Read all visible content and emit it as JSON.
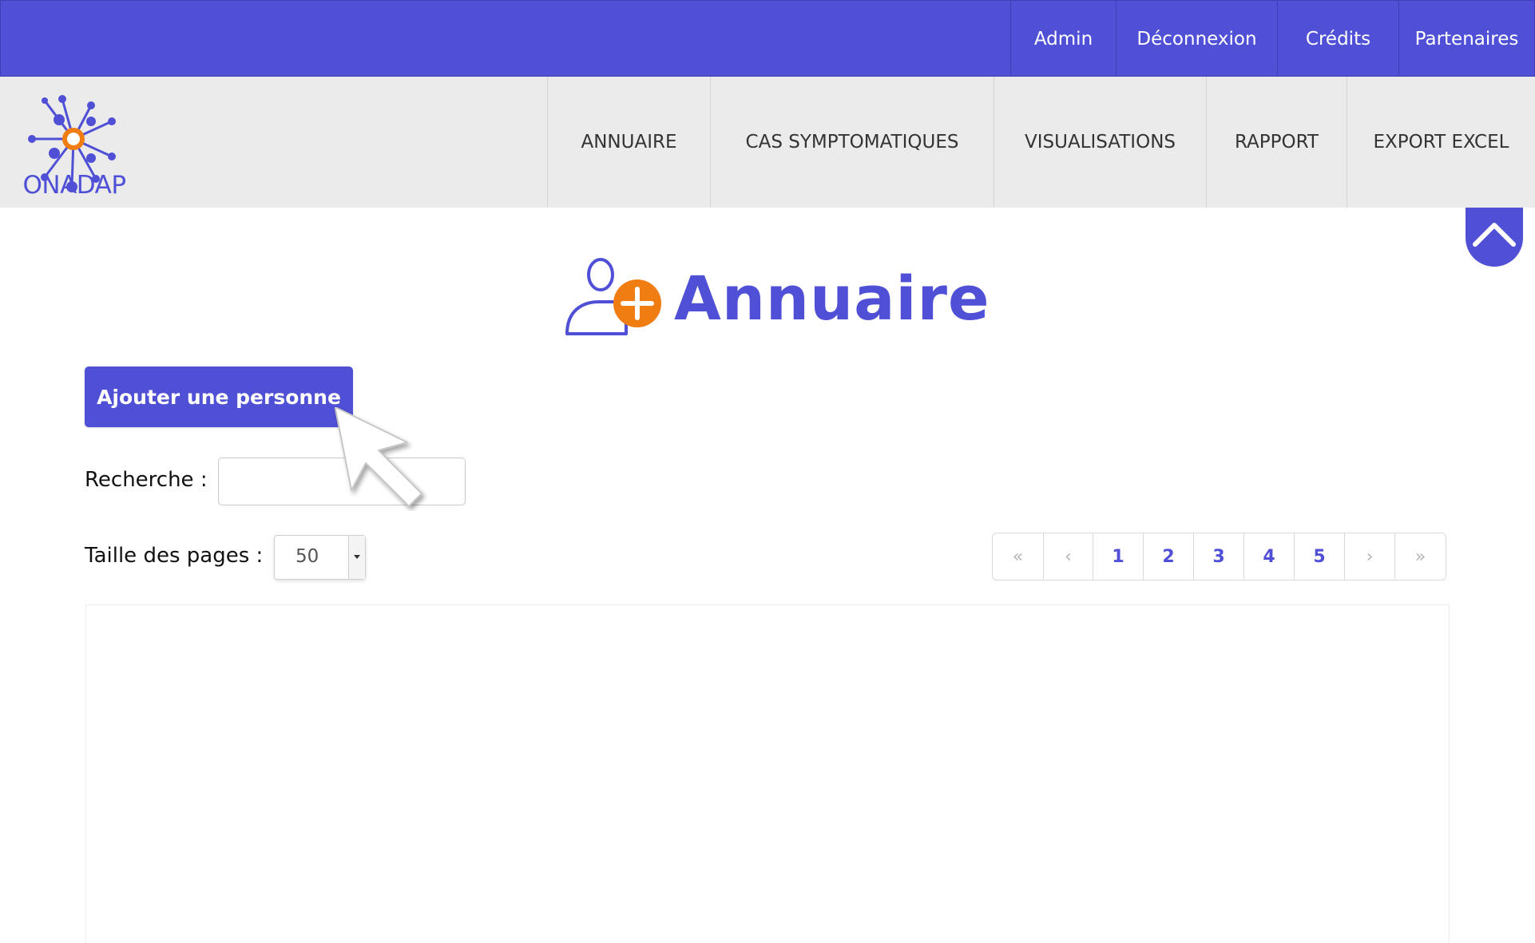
{
  "topbar": {
    "links": [
      {
        "label": "Admin",
        "name": "topbar-link-admin"
      },
      {
        "label": "Déconnexion",
        "name": "topbar-link-deconnexion"
      },
      {
        "label": "Crédits",
        "name": "topbar-link-credits"
      },
      {
        "label": "Partenaires",
        "name": "topbar-link-partenaires"
      }
    ]
  },
  "nav": {
    "logo_text": "ONADAP",
    "items": [
      {
        "label": "ANNUAIRE"
      },
      {
        "label": "CAS SYMPTOMATIQUES"
      },
      {
        "label": "VISUALISATIONS"
      },
      {
        "label": "RAPPORT"
      },
      {
        "label": "EXPORT EXCEL"
      }
    ]
  },
  "page": {
    "title": "Annuaire",
    "add_button_label": "Ajouter une personne",
    "search_label": "Recherche :",
    "search_value": "",
    "page_size_label": "Taille des pages :",
    "page_size_value": "50"
  },
  "pager": {
    "first": "«",
    "prev": "‹",
    "pages": [
      "1",
      "2",
      "3",
      "4",
      "5"
    ],
    "next": "›",
    "last": "»"
  },
  "colors": {
    "brand": "#4f50d6",
    "accent": "#f07d12",
    "nav_bg": "#ebebeb"
  },
  "icons": {
    "title": "user-add-icon",
    "scroll": "chevron-up-icon",
    "cursor": "mouse-pointer-icon"
  }
}
